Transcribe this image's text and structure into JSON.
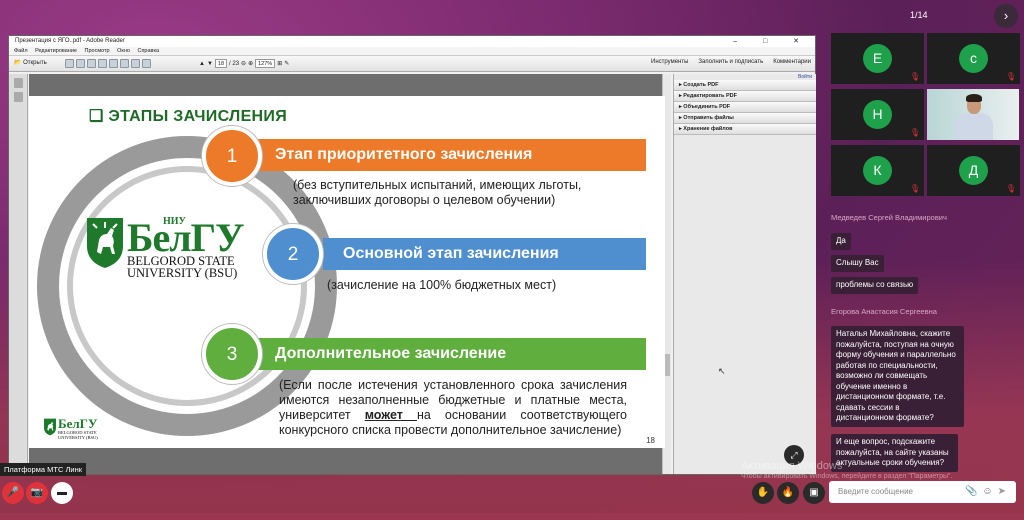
{
  "meeting": {
    "page_counter": "1/14",
    "next_icon": "chevron-right-icon",
    "platform_label": "Платформа МТС Линк"
  },
  "reader": {
    "title": "Презентация с ЯГО..pdf - Adobe Reader",
    "menu": [
      "Файл",
      "Редактирование",
      "Просмотр",
      "Окно",
      "Справка"
    ],
    "open_label": "Открыть",
    "page_value": "18",
    "page_total": "/ 23",
    "zoom": "127%",
    "tools_label": "Инструменты",
    "fill_sign_label": "Заполнить и подписать",
    "comments_label": "Комментарии",
    "login_label": "Войти",
    "panel_items": [
      "Создать PDF",
      "Редактировать PDF",
      "Объединить PDF",
      "Отправить файлы",
      "Хранение файлов"
    ]
  },
  "slide": {
    "title": "❑ ЭТАПЫ ЗАЧИСЛЕНИЯ",
    "logo": {
      "name": "БелГУ",
      "niu": "НИУ",
      "line1": "BELGOROD STATE",
      "line2": "UNIVERSITY (BSU)"
    },
    "stages": [
      {
        "num": "1",
        "label": "Этап приоритетного зачисления",
        "desc": "(без вступительных испытаний, имеющих льготы, заключивших договоры о целевом обучении)",
        "color": "#ec7a28"
      },
      {
        "num": "2",
        "label": "Основной этап зачисления",
        "desc": "(зачисление на 100% бюджетных мест)",
        "color": "#4f8fd0"
      },
      {
        "num": "3",
        "label": "Дополнительное зачисление",
        "desc_a": "(Если после истечения установленного срока зачисления имеются незаполненные бюджетные и платные места, университет ",
        "desc_b": "может ",
        "desc_c": "на основании соответствующего конкурсного списка провести дополнительное зачисление)",
        "color": "#5fae3e"
      }
    ],
    "page_number": "18"
  },
  "participants": [
    {
      "initial": "Е"
    },
    {
      "initial": "с"
    },
    {
      "initial": "Н"
    },
    {
      "initial": "К"
    },
    {
      "initial": "Д"
    }
  ],
  "chat": {
    "sender1": "Медведев Сергей Владимирович",
    "msg1": "Да",
    "msg2": "Слышу Вас",
    "msg3": "проблемы со связью",
    "sender2": "Егорова Анастасия Сергеевна",
    "msg4": "Наталья Михайловна, скажите пожалуйста, поступая на очную форму обучения и параллельно работая по специальности, возможно ли совмещать обучение именно в дистанционном формате, т.е. сдавать сессии в дистанционном формате?",
    "msg5": "И еще вопрос, подскажите пожалуйста, на сайте указаны актуальные сроки обучения?",
    "input_placeholder": "Введите сообщение"
  },
  "watermark": {
    "line1": "Активация Windows",
    "line2": "Чтобы активировать Windows, перейдите в раздел \"Параметры\"."
  },
  "colors": {
    "accent_green": "#1e6a26",
    "mic_off": "#e0323a"
  }
}
